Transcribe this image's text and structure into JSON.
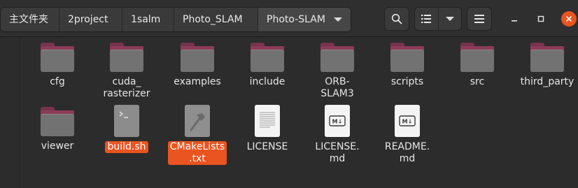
{
  "breadcrumb": [
    "主文件夹",
    "2project",
    "1salm",
    "Photo_SLAM",
    "Photo-SLAM"
  ],
  "files": [
    {
      "name": "cfg",
      "type": "folder",
      "selected": false
    },
    {
      "name": "cuda_\nrasterizer",
      "type": "folder",
      "selected": false
    },
    {
      "name": "examples",
      "type": "folder",
      "selected": false
    },
    {
      "name": "include",
      "type": "folder",
      "selected": false
    },
    {
      "name": "ORB-\nSLAM3",
      "type": "folder",
      "selected": false
    },
    {
      "name": "scripts",
      "type": "folder",
      "selected": false
    },
    {
      "name": "src",
      "type": "folder",
      "selected": false
    },
    {
      "name": "third_party",
      "type": "folder",
      "selected": false
    },
    {
      "name": "viewer",
      "type": "folder",
      "selected": false
    },
    {
      "name": "build.sh",
      "type": "script",
      "selected": true
    },
    {
      "name": "CMakeLists\n.txt",
      "type": "cmake",
      "selected": true
    },
    {
      "name": "LICENSE",
      "type": "text",
      "selected": false
    },
    {
      "name": "LICENSE.\nmd",
      "type": "markdown",
      "selected": false
    },
    {
      "name": "README.\nmd",
      "type": "markdown",
      "selected": false
    }
  ],
  "icons": {
    "path_dropdown": "chevron-down-icon",
    "search": "search-icon",
    "view_list": "list-view-icon",
    "view_options": "chevron-down-icon",
    "menu": "hamburger-icon",
    "minimize": "minimize-icon",
    "maximize": "maximize-icon",
    "close": "close-icon",
    "markdown_badge": "M↓"
  },
  "colors": {
    "selection": "#e95420",
    "folder_tab": "#8c3b58",
    "folder_body": "#727272",
    "close_button": "#e95420"
  }
}
